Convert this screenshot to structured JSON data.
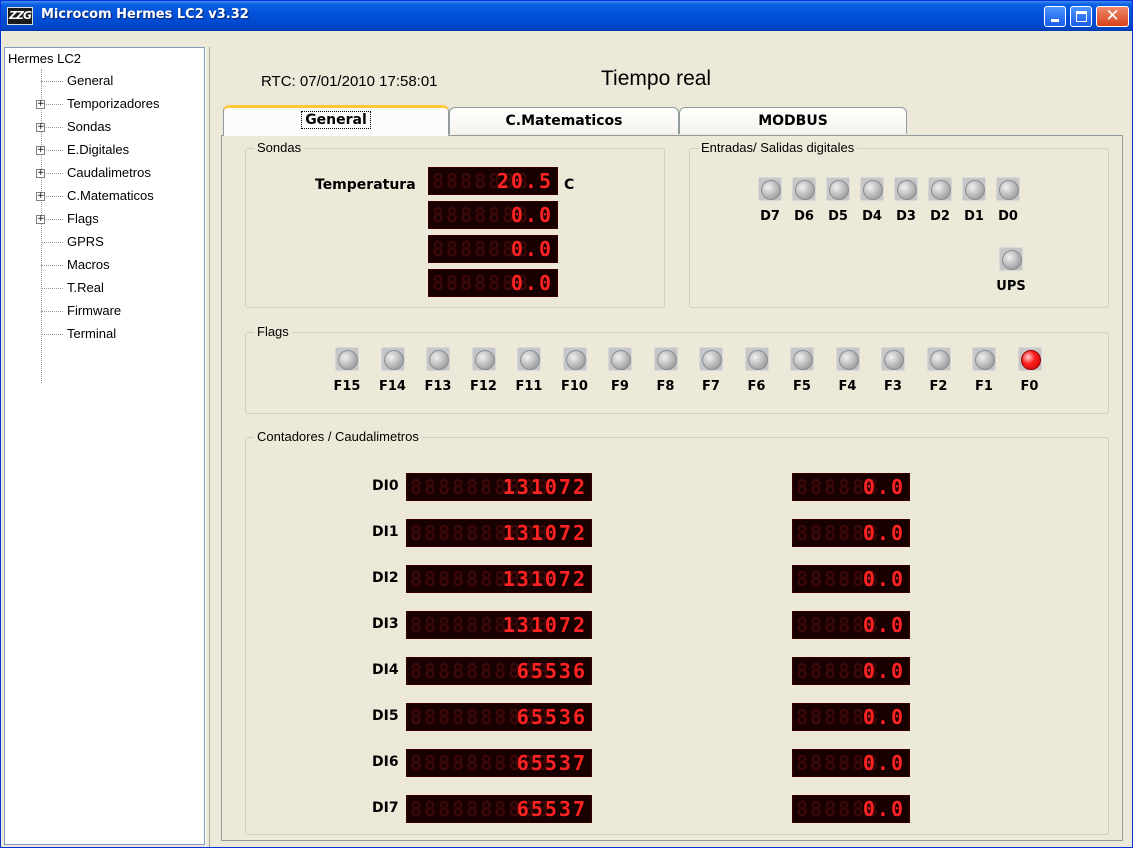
{
  "window": {
    "title": "Microcom Hermes LC2 v3.32",
    "icon_text": "ZZG"
  },
  "tree": {
    "root": "Hermes LC2",
    "items": [
      {
        "label": "General",
        "expandable": false
      },
      {
        "label": "Temporizadores",
        "expandable": true
      },
      {
        "label": "Sondas",
        "expandable": true
      },
      {
        "label": "E.Digitales",
        "expandable": true
      },
      {
        "label": "Caudalimetros",
        "expandable": true
      },
      {
        "label": "C.Matematicos",
        "expandable": true
      },
      {
        "label": "Flags",
        "expandable": true
      },
      {
        "label": "GPRS",
        "expandable": false
      },
      {
        "label": "Macros",
        "expandable": false
      },
      {
        "label": "T.Real",
        "expandable": false
      },
      {
        "label": "Firmware",
        "expandable": false
      },
      {
        "label": "Terminal",
        "expandable": false
      }
    ]
  },
  "header": {
    "rtc": "RTC: 07/01/2010 17:58:01",
    "title": "Tiempo real"
  },
  "tabs": [
    {
      "label": "General",
      "active": true
    },
    {
      "label": "C.Matematicos",
      "active": false
    },
    {
      "label": "MODBUS",
      "active": false
    }
  ],
  "sondas": {
    "title": "Sondas",
    "temp_label": "Temperatura",
    "unit": "C",
    "displays": [
      "20.5",
      "0.0",
      "0.0",
      "0.0"
    ]
  },
  "digital": {
    "title": "Entradas/ Salidas digitales",
    "inputs": [
      {
        "label": "D7",
        "on": false
      },
      {
        "label": "D6",
        "on": false
      },
      {
        "label": "D5",
        "on": false
      },
      {
        "label": "D4",
        "on": false
      },
      {
        "label": "D3",
        "on": false
      },
      {
        "label": "D2",
        "on": false
      },
      {
        "label": "D1",
        "on": false
      },
      {
        "label": "D0",
        "on": false
      }
    ],
    "ups": {
      "label": "UPS",
      "on": false
    }
  },
  "flags": {
    "title": "Flags",
    "items": [
      {
        "label": "F15",
        "on": false
      },
      {
        "label": "F14",
        "on": false
      },
      {
        "label": "F13",
        "on": false
      },
      {
        "label": "F12",
        "on": false
      },
      {
        "label": "F11",
        "on": false
      },
      {
        "label": "F10",
        "on": false
      },
      {
        "label": "F9",
        "on": false
      },
      {
        "label": "F8",
        "on": false
      },
      {
        "label": "F7",
        "on": false
      },
      {
        "label": "F6",
        "on": false
      },
      {
        "label": "F5",
        "on": false
      },
      {
        "label": "F4",
        "on": false
      },
      {
        "label": "F3",
        "on": false
      },
      {
        "label": "F2",
        "on": false
      },
      {
        "label": "F1",
        "on": false
      },
      {
        "label": "F0",
        "on": true
      }
    ]
  },
  "counters": {
    "title": "Contadores / Caudalimetros",
    "rows": [
      {
        "label": "DI0",
        "count": "131072",
        "flow": "0.0"
      },
      {
        "label": "DI1",
        "count": "131072",
        "flow": "0.0"
      },
      {
        "label": "DI2",
        "count": "131072",
        "flow": "0.0"
      },
      {
        "label": "DI3",
        "count": "131072",
        "flow": "0.0"
      },
      {
        "label": "DI4",
        "count": "65536",
        "flow": "0.0"
      },
      {
        "label": "DI5",
        "count": "65536",
        "flow": "0.0"
      },
      {
        "label": "DI6",
        "count": "65537",
        "flow": "0.0"
      },
      {
        "label": "DI7",
        "count": "65537",
        "flow": "0.0"
      }
    ]
  },
  "colors": {
    "titlebar": "#0050d8",
    "lcd_on": "#ff2222",
    "lcd_bg": "#180000",
    "led_on": "#ff2020"
  }
}
